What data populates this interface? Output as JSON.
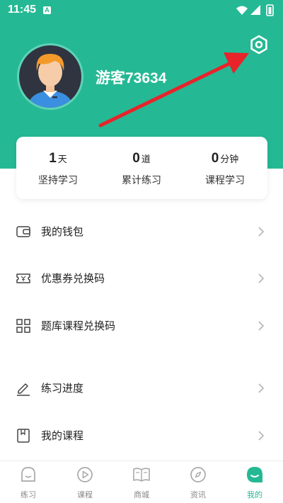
{
  "status_bar": {
    "time": "11:45",
    "notification_letter": "A"
  },
  "profile": {
    "username": "游客73634"
  },
  "stats": [
    {
      "value": "1",
      "unit": "天",
      "label": "坚持学习"
    },
    {
      "value": "0",
      "unit": "道",
      "label": "累计练习"
    },
    {
      "value": "0",
      "unit": "分钟",
      "label": "课程学习"
    }
  ],
  "menu": [
    {
      "label": "我的钱包",
      "icon": "wallet-icon"
    },
    {
      "label": "优惠券兑换码",
      "icon": "coupon-icon"
    },
    {
      "label": "题库课程兑换码",
      "icon": "grid-icon"
    },
    {
      "label": "练习进度",
      "icon": "edit-pencil-icon"
    },
    {
      "label": "我的课程",
      "icon": "bookmark-icon"
    }
  ],
  "tabs": [
    {
      "label": "练习",
      "icon": "practice-icon",
      "active": false
    },
    {
      "label": "课程",
      "icon": "play-icon",
      "active": false
    },
    {
      "label": "商城",
      "icon": "book-icon",
      "active": false
    },
    {
      "label": "资讯",
      "icon": "compass-icon",
      "active": false
    },
    {
      "label": "我的",
      "icon": "profile-icon",
      "active": true
    }
  ],
  "colors": {
    "primary": "#25b894",
    "arrow": "#e8232a"
  }
}
